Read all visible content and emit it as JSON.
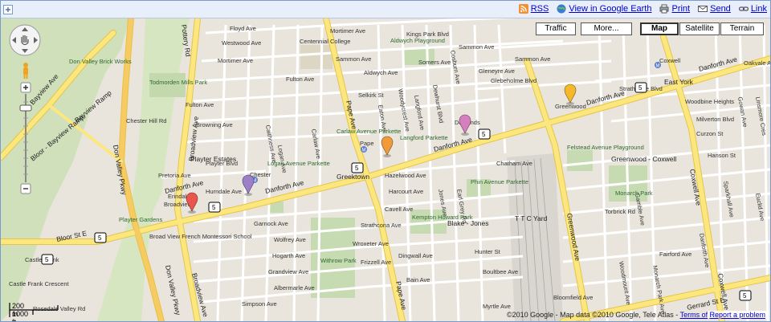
{
  "topbar": {
    "links": [
      {
        "label": "RSS",
        "icon": "rss-icon"
      },
      {
        "label": "View in Google Earth",
        "icon": "google-earth-icon"
      },
      {
        "label": "Print",
        "icon": "print-icon"
      },
      {
        "label": "Send",
        "icon": "mail-icon"
      },
      {
        "label": "Link",
        "icon": "link-icon"
      }
    ]
  },
  "map_controls": {
    "traffic": "Traffic",
    "more": "More...",
    "map": "Map",
    "satellite": "Satellite",
    "terrain": "Terrain"
  },
  "scale": {
    "metric": "200 m",
    "imperial": "1000 ft"
  },
  "footer": {
    "copyright": "©2010 Google - Map data ©2010 Google, Tele Atlas -",
    "terms": "Terms of Use",
    "report": "Report a problem"
  },
  "colors": {
    "road_major": "#fbe77e",
    "road_major_edge": "#e6c44a",
    "park": "#c6dbb1",
    "land": "#e9e5dc",
    "link": "#0000cc"
  },
  "roads": {
    "danforth_1": "Danforth Ave",
    "danforth_2": "Danforth Ave",
    "danforth_3": "Danforth Ave",
    "danforth_4": "Danforth Ave",
    "danforth_5": "Danforth Ave",
    "don_valley": "Don Valley Pkwy",
    "don_valley_2": "Don Valley Pkwy",
    "bayview": "Bayview Ave",
    "bayview_ramp": "Bayview Ramp",
    "bloor": "Bloor St E",
    "bloor_2": "Bloor - Bayview Ramp",
    "broadview": "Broadview Ave",
    "broadview_2": "Broadview Ave",
    "pape": "Pape Ave",
    "pape_2": "Pape Ave",
    "greenwood": "Greenwood Ave",
    "coxwell": "Coxwell Ave",
    "coxwell_2": "Coxwell Ave",
    "gerrard": "Gerrard St E",
    "pottery": "Pottery Rd"
  },
  "streets": [
    "Floyd Ave",
    "Westwood Ave",
    "Mortimer Ave",
    "Mortimer Ave",
    "Sammon Ave",
    "Sammon Ave",
    "Somers Ave",
    "Aldwych Ave",
    "Fulton Ave",
    "Browning Ave",
    "Fulton Ave",
    "Selkirk St",
    "Chester Hill Rd",
    "Playter Blvd",
    "Pretoria Ave",
    "Hurndale Ave",
    "Logan Ave",
    "Carlaw Ave",
    "Jones Ave",
    "Hazelwood Ave",
    "Harcourt Ave",
    "Cavell Ave",
    "Garnock Ave",
    "Wolfrey Ave",
    "Hogarth Ave",
    "Grandview Ave",
    "Albermarle Ave",
    "Simpson Ave",
    "Strathcona Ave",
    "Wroxeter Ave",
    "Frizzell Ave",
    "Dingwall Ave",
    "Bain Ave",
    "Hunter St",
    "Boultbee Ave",
    "Myrtle Ave",
    "Bloomfield Ave",
    "Torbrick Rd",
    "Fairford Ave",
    "Hanson St",
    "Chatham Ave",
    "Strathmore Blvd",
    "Gleneyre Ave",
    "Glebeholme Blvd",
    "Woodbine Heights",
    "Milverton Blvd",
    "Curzon St",
    "Eaton Ave",
    "Langford Ave",
    "Woodycrest Ave",
    "Dewhurst Blvd",
    "Cosburn Ave",
    "Gamble Ave",
    "Sammon Ave",
    "Woodmount Ave",
    "Monarch Park Ave",
    "Danforth Ave",
    "Earl Grey Rd",
    "Oakvale Ave",
    "Sparkhall Ave",
    "Gowan Ave",
    "Linsmore Cres",
    "Euclid Ave",
    "Caithness Ave"
  ],
  "places": {
    "don_valley_brick": "Don Valley Brick Works",
    "todmorden": "Todmorden Mills Park",
    "centennial": "Centennial College",
    "aldwych": "Aldwych Playground",
    "kings_park": "Kings Park Blvd",
    "pape_station": "Pape",
    "langford": "Langford Parkette",
    "carlaw": "Carlaw Avenue Parkette",
    "logan": "Logan Avenue Parkette",
    "greektown": "Greektown",
    "playter": "Playter Estates",
    "chester": "Chester",
    "broadview_stn": "Broadview",
    "erindale": "Erindale",
    "playter_gardens": "Playter Gardens",
    "montessori": "Broad View French Montessori School",
    "castle_frank": "Castle Frank",
    "phin": "Phin Avenue Parkette",
    "kempton": "Kempton Howard Park",
    "blake_jones": "Blake - Jones",
    "withrow": "Withrow Park",
    "ttc_yard": "T T C Yard",
    "felstead": "Felstead Avenue Playground",
    "greenwood_coxwell": "Greenwood - Coxwell",
    "monarch": "Monarch Park",
    "east_york": "East York",
    "coxwell_stn": "Coxwell",
    "greenwood_stn": "Greenwood",
    "donlands": "Donlands",
    "rosedale": "Rosedale Valley Rd",
    "castle_frank_cres": "Castle Frank Crescent"
  },
  "shields": [
    "5",
    "5",
    "5",
    "5",
    "5",
    "5",
    "5",
    "5"
  ],
  "markers": [
    {
      "name": "marker-red",
      "color": "#e8564e"
    },
    {
      "name": "marker-purple",
      "color": "#9b80c8"
    },
    {
      "name": "marker-orange",
      "color": "#f09a3a"
    },
    {
      "name": "marker-pink",
      "color": "#d57fbe"
    },
    {
      "name": "marker-yellow",
      "color": "#f4b82a"
    }
  ]
}
